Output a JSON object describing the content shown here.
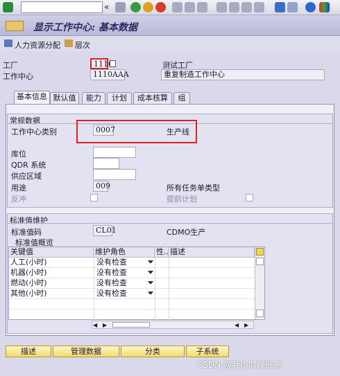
{
  "toolbar": {
    "cmd_value": ""
  },
  "title": "显示工作中心: 基本数据",
  "appbar": {
    "btn1": "人力资源分配",
    "btn2": "层次"
  },
  "header": {
    "plant_label": "工厂",
    "plant_value": "1110",
    "plant_desc": "测试工厂",
    "wc_label": "工作中心",
    "wc_value": "1110AAA",
    "wc_desc": "重复制造工作中心"
  },
  "tabs": [
    {
      "label": "基本信息"
    },
    {
      "label": "默认值"
    },
    {
      "label": "能力"
    },
    {
      "label": "计划"
    },
    {
      "label": "成本核算"
    },
    {
      "label": "组"
    }
  ],
  "general": {
    "group_title": "常规数据",
    "category_label": "工作中心类别",
    "category_value": "0007",
    "category_desc": "生产线",
    "storage_label": "库位",
    "qdr_label": "QDR 系统",
    "supply_label": "供应区域",
    "usage_label": "用途",
    "usage_value": "009",
    "usage_desc": "所有任务单类型",
    "backflush_label": "反冲",
    "advance_label": "提前计划"
  },
  "standard": {
    "group_title": "标准值维护",
    "code_label": "标准值码",
    "code_value": "CL01",
    "code_desc": "CDMO生产",
    "overview_title": "标准值概览",
    "columns": [
      "关键值",
      "维护角色",
      "性..",
      "描述"
    ],
    "rows": [
      {
        "key": "人工(小时)",
        "role": "没有检查"
      },
      {
        "key": "机器(小时)",
        "role": "没有检查"
      },
      {
        "key": "燃动(小时)",
        "role": "没有检查"
      },
      {
        "key": "其他(小时)",
        "role": "没有检查"
      }
    ]
  },
  "buttons": [
    "描述",
    "管理数据",
    "分类",
    "子系统"
  ],
  "watermark": "CSDN @我小时候很黑",
  "colors": {
    "highlight": "#e0201e",
    "accent": "#2a2a63"
  }
}
